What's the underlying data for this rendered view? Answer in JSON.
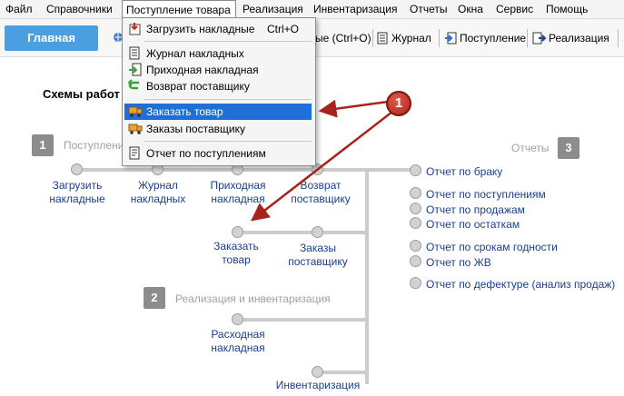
{
  "menubar": {
    "items": [
      {
        "label": "Файл"
      },
      {
        "label": "Справочники"
      },
      {
        "label": "Поступление товара"
      },
      {
        "label": "Реализация"
      },
      {
        "label": "Инвентаризация"
      },
      {
        "label": "Отчеты"
      },
      {
        "label": "Окна"
      },
      {
        "label": "Сервис"
      },
      {
        "label": "Помощь"
      }
    ]
  },
  "toolbar": {
    "home_tab": "Главная",
    "obscured_button": "ые (Ctrl+O)",
    "journal": "Журнал",
    "receipt": "Поступление",
    "sales": "Реализация"
  },
  "dropdown": {
    "items": [
      {
        "label": "Загрузить накладные",
        "shortcut": "Ctrl+O",
        "icon": "download-icon"
      },
      {
        "label": "Журнал накладных",
        "icon": "journal-icon"
      },
      {
        "label": "Приходная накладная",
        "icon": "incoming-icon"
      },
      {
        "label": "Возврат поставщику",
        "icon": "return-icon"
      },
      {
        "label": "Заказать товар",
        "icon": "truck-icon"
      },
      {
        "label": "Заказы поставщику",
        "icon": "truck-icon"
      },
      {
        "label": "Отчет по поступлениям",
        "icon": "report-icon"
      }
    ]
  },
  "main": {
    "heading": "Схемы работ",
    "sections": {
      "receipt": {
        "num": "1",
        "title": "Поступлени"
      },
      "reports": {
        "num": "3",
        "title": "Отчеты"
      },
      "sales": {
        "num": "2",
        "title": "Реализация и инвентаризация"
      }
    },
    "nodes": {
      "load_l1": "Загрузить",
      "load_l2": "накладные",
      "journal_l1": "Журнал",
      "journal_l2": "накладных",
      "incoming_l1": "Приходная",
      "incoming_l2": "накладная",
      "return_l1": "Возврат",
      "return_l2": "поставщику",
      "order_l1": "Заказать",
      "order_l2": "товар",
      "orders_l1": "Заказы",
      "orders_l2": "поставщику",
      "expense_l1": "Расходная",
      "expense_l2": "накладная",
      "inventory": "Инвентаризация"
    },
    "reports": [
      "Отчет по браку",
      "Отчет по поступлениям",
      "Отчет по продажам",
      "Отчет по остаткам",
      "Отчет по срокам годности",
      "Отчет по ЖВ",
      "Отчет по дефектуре (анализ продаж)"
    ]
  },
  "callout": {
    "number": "1"
  },
  "colors": {
    "accent": "#4a9fe0",
    "highlight": "#1f6fd8",
    "link": "#1a3e8c",
    "callout": "#c0392b"
  }
}
